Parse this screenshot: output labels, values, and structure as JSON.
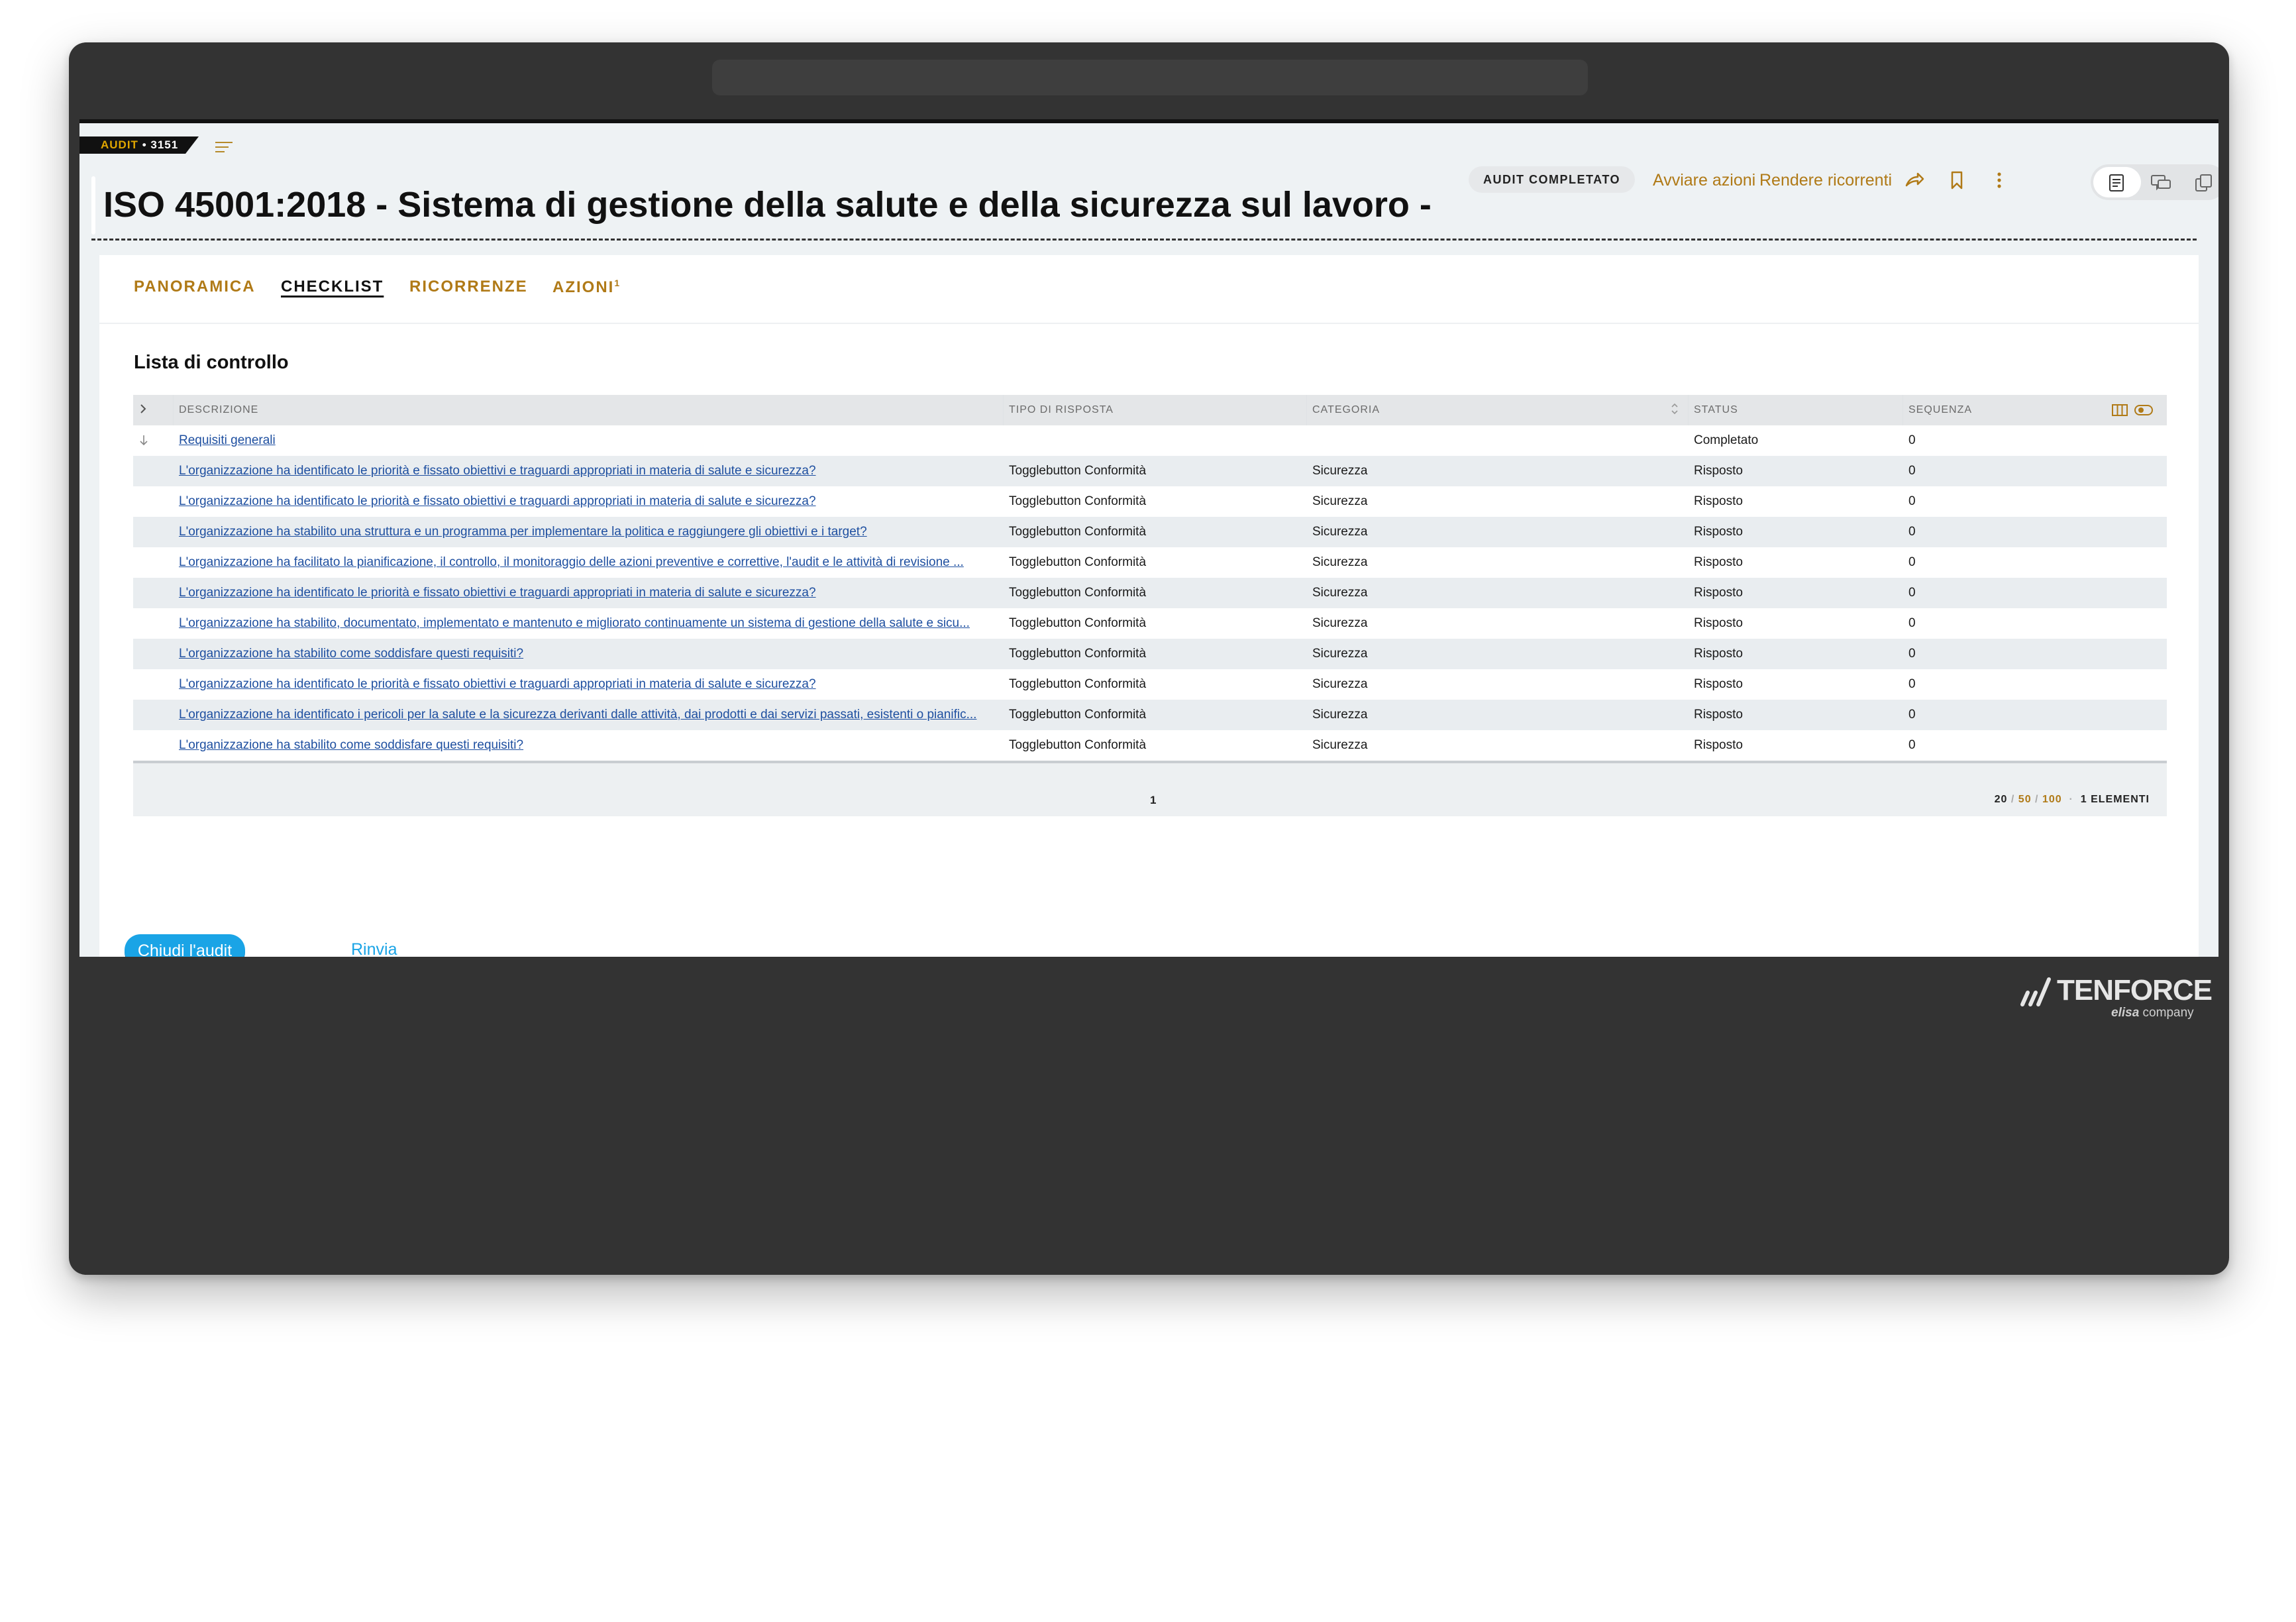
{
  "header": {
    "tag_label": "AUDIT",
    "tag_separator": "•",
    "tag_id": "3151",
    "title": "ISO 45001:2018 - Sistema di gestione della salute e della sicurezza sul lavoro -",
    "status": "AUDIT COMPLETATO",
    "action_start": "Avviare azioni",
    "action_recurring": "Rendere ricorrenti",
    "icons": [
      "share-icon",
      "bookmark-icon",
      "more-vertical-icon",
      "document-view-icon",
      "comments-view-icon",
      "copies-view-icon"
    ]
  },
  "tabs": [
    {
      "label": "PANORAMICA",
      "active": false
    },
    {
      "label": "CHECKLIST",
      "active": true
    },
    {
      "label": "RICORRENZE",
      "active": false
    },
    {
      "label": "AZIONI",
      "badge": "1",
      "active": false
    }
  ],
  "section_title": "Lista di controllo",
  "grid": {
    "columns": [
      "DESCRIZIONE",
      "TIPO DI RISPOSTA",
      "CATEGORIA",
      "STATUS",
      "SEQUENZA"
    ],
    "rows": [
      {
        "descrizione": "Requisiti generali",
        "tipo": "",
        "categoria": "",
        "status": "Completato",
        "sequenza": "0"
      },
      {
        "descrizione": "L'organizzazione ha identificato le priorità e fissato obiettivi e traguardi appropriati in materia di salute e sicurezza?",
        "tipo": "Togglebutton Conformità",
        "categoria": "Sicurezza",
        "status": "Risposto",
        "sequenza": "0"
      },
      {
        "descrizione": "L'organizzazione ha identificato le priorità e fissato obiettivi e traguardi appropriati in materia di salute e sicurezza?",
        "tipo": "Togglebutton Conformità",
        "categoria": "Sicurezza",
        "status": "Risposto",
        "sequenza": "0"
      },
      {
        "descrizione": "L'organizzazione ha stabilito una struttura e un programma per implementare la politica e raggiungere gli obiettivi e i target?",
        "tipo": "Togglebutton Conformità",
        "categoria": "Sicurezza",
        "status": "Risposto",
        "sequenza": "0"
      },
      {
        "descrizione": "L'organizzazione ha facilitato la pianificazione, il controllo, il monitoraggio delle azioni preventive e correttive, l'audit e le attività di revisione ...",
        "tipo": "Togglebutton Conformità",
        "categoria": "Sicurezza",
        "status": "Risposto",
        "sequenza": "0"
      },
      {
        "descrizione": "L'organizzazione ha identificato le priorità e fissato obiettivi e traguardi appropriati in materia di salute e sicurezza?",
        "tipo": "Togglebutton Conformità",
        "categoria": "Sicurezza",
        "status": "Risposto",
        "sequenza": "0"
      },
      {
        "descrizione": "L'organizzazione ha stabilito, documentato, implementato e mantenuto e migliorato continuamente un sistema di gestione della salute e sicu...",
        "tipo": "Togglebutton Conformità",
        "categoria": "Sicurezza",
        "status": "Risposto",
        "sequenza": "0"
      },
      {
        "descrizione": "L'organizzazione ha stabilito come soddisfare questi requisiti?",
        "tipo": "Togglebutton Conformità",
        "categoria": "Sicurezza",
        "status": "Risposto",
        "sequenza": "0"
      },
      {
        "descrizione": "L'organizzazione ha identificato le priorità e fissato obiettivi e traguardi appropriati in materia di salute e sicurezza?",
        "tipo": "Togglebutton Conformità",
        "categoria": "Sicurezza",
        "status": "Risposto",
        "sequenza": "0"
      },
      {
        "descrizione": "L'organizzazione ha identificato i pericoli per la salute e la sicurezza derivanti dalle attività, dai prodotti e dai servizi passati, esistenti o pianific...",
        "tipo": "Togglebutton Conformità",
        "categoria": "Sicurezza",
        "status": "Risposto",
        "sequenza": "0"
      },
      {
        "descrizione": "L'organizzazione ha stabilito come soddisfare questi requisiti?",
        "tipo": "Togglebutton Conformità",
        "categoria": "Sicurezza",
        "status": "Risposto",
        "sequenza": "0"
      }
    ],
    "footer": {
      "page": "1",
      "size_20": "20",
      "size_50": "50",
      "size_100": "100",
      "divider": "/",
      "dot": "·",
      "count": "1 ELEMENTI"
    }
  },
  "actions": {
    "close_label": "Chiudi l'audit",
    "postpone_label": "Rinvia"
  },
  "logo": {
    "name": "TENFORCE",
    "sub_brand": "elisa",
    "sub_suffix": "company"
  },
  "colors": {
    "accent_gold": "#b07a17",
    "primary_blue": "#1aa4e6",
    "link_blue": "#1e4fa0",
    "frame": "#333333"
  }
}
